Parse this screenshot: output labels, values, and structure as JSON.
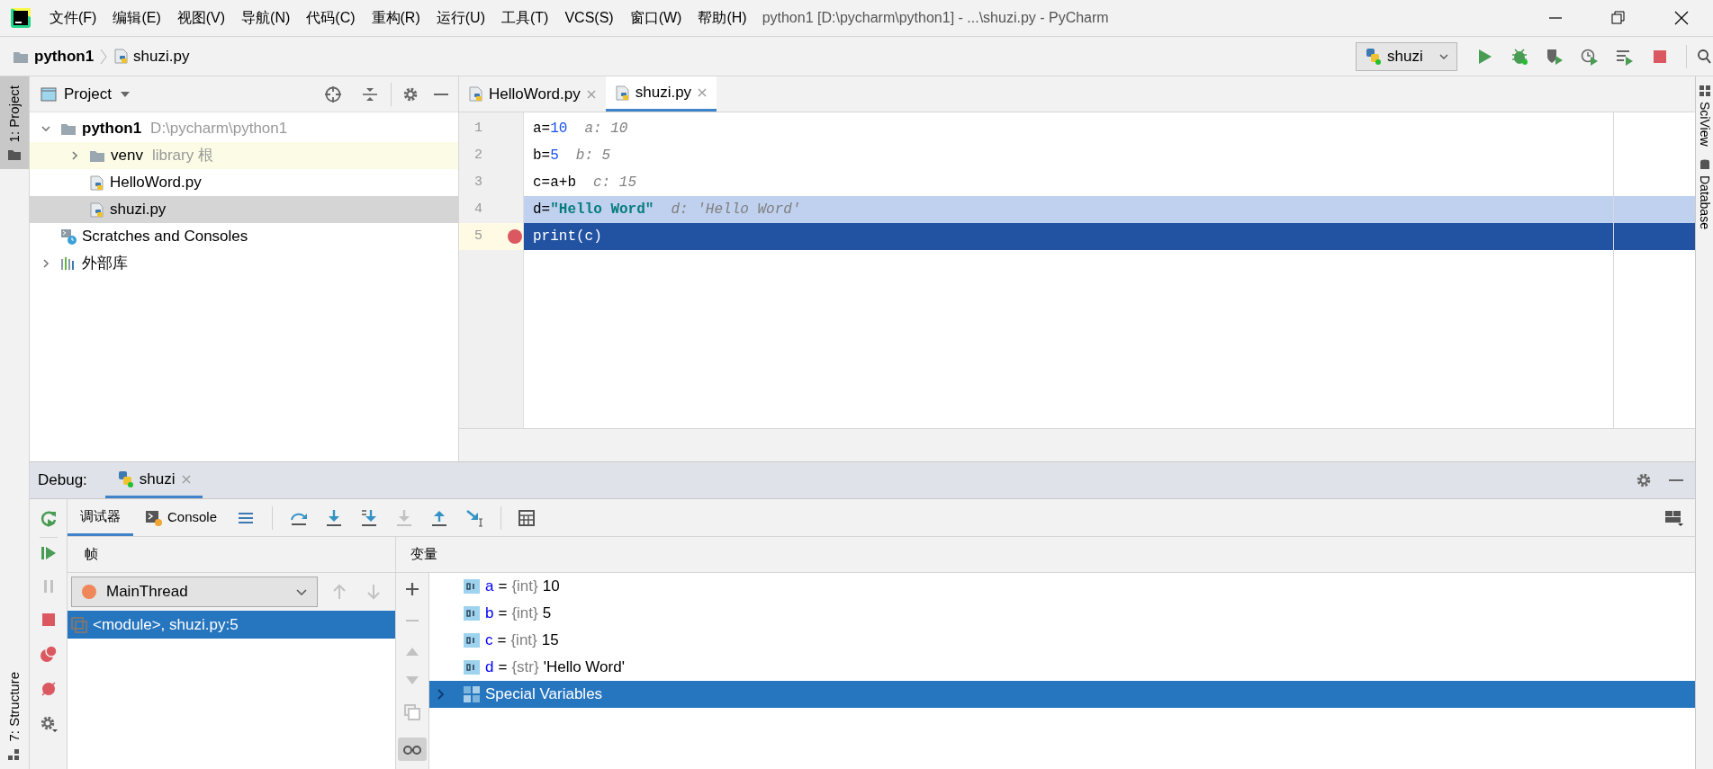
{
  "menu": [
    "文件(F)",
    "编辑(E)",
    "视图(V)",
    "导航(N)",
    "代码(C)",
    "重构(R)",
    "运行(U)",
    "工具(T)",
    "VCS(S)",
    "窗口(W)",
    "帮助(H)"
  ],
  "window_title": "python1 [D:\\pycharm\\python1] - ...\\shuzi.py - PyCharm",
  "breadcrumbs": [
    "python1",
    "shuzi.py"
  ],
  "run_config": "shuzi",
  "left_tool_tabs": [
    {
      "label": "1: Project",
      "selected": true,
      "kind": "project"
    },
    {
      "label": "7: Structure",
      "selected": false,
      "kind": "structure"
    }
  ],
  "right_tool_tabs": [
    {
      "label": "SciView",
      "kind": "sciview"
    },
    {
      "label": "Database",
      "kind": "database"
    }
  ],
  "project_panel": {
    "title": "Project",
    "tree": [
      {
        "label": "python1",
        "hint": "D:\\pycharm\\python1",
        "kind": "project",
        "expanded": true,
        "selected": false,
        "library_root": false,
        "children": [
          {
            "label": "venv",
            "hint": "library 根",
            "kind": "folder",
            "expanded": false,
            "selected": false,
            "library_root": true
          },
          {
            "label": "HelloWord.py",
            "kind": "python",
            "selected": false,
            "library_root": false
          },
          {
            "label": "shuzi.py",
            "kind": "python",
            "selected": true,
            "library_root": false
          }
        ]
      },
      {
        "label": "Scratches and Consoles",
        "kind": "scratches",
        "selected": false,
        "library_root": false
      },
      {
        "label": "外部库",
        "kind": "library",
        "expanded": false,
        "selected": false,
        "library_root": false
      }
    ]
  },
  "editor": {
    "tabs": [
      {
        "label": "HelloWord.py",
        "selected": false
      },
      {
        "label": "shuzi.py",
        "selected": true
      }
    ],
    "lines": [
      {
        "number": "1",
        "tokens": [
          {
            "text": "a=",
            "kind": "plain"
          },
          {
            "text": "10",
            "kind": "number"
          }
        ],
        "inline_value": "a: 10",
        "breakpoint": false,
        "selected": false,
        "execution_point": false
      },
      {
        "number": "2",
        "tokens": [
          {
            "text": "b=",
            "kind": "plain"
          },
          {
            "text": "5",
            "kind": "number"
          }
        ],
        "inline_value": "b: 5",
        "breakpoint": false,
        "selected": false,
        "execution_point": false
      },
      {
        "number": "3",
        "tokens": [
          {
            "text": "c=a+b",
            "kind": "plain"
          }
        ],
        "inline_value": "c: 15",
        "breakpoint": false,
        "selected": false,
        "execution_point": false
      },
      {
        "number": "4",
        "tokens": [
          {
            "text": "d=",
            "kind": "plain"
          },
          {
            "text": "\"Hello Word\"",
            "kind": "string"
          }
        ],
        "inline_value": "d: 'Hello Word'",
        "breakpoint": false,
        "selected": true,
        "execution_point": false
      },
      {
        "number": "5",
        "tokens": [
          {
            "text": "print(c)",
            "kind": "plain"
          }
        ],
        "breakpoint": true,
        "selected": false,
        "execution_point": true
      }
    ]
  },
  "debug": {
    "title": "Debug:",
    "session_tab": {
      "label": "shuzi",
      "selected": true
    },
    "subtabs": [
      {
        "label": "调试器",
        "selected": true,
        "kind": "debugger"
      },
      {
        "label": "Console",
        "selected": false,
        "kind": "console"
      }
    ],
    "frames_header": "帧",
    "variables_header": "变量",
    "thread": "MainThread",
    "frames": [
      {
        "label": "<module>, shuzi.py:5",
        "selected": true
      }
    ],
    "variables": [
      {
        "kind": "variable",
        "name": "a",
        "operator": "=",
        "type": "{int}",
        "value": "10",
        "selected": false
      },
      {
        "kind": "variable",
        "name": "b",
        "operator": "=",
        "type": "{int}",
        "value": "5",
        "selected": false
      },
      {
        "kind": "variable",
        "name": "c",
        "operator": "=",
        "type": "{int}",
        "value": "15",
        "selected": false
      },
      {
        "kind": "variable",
        "name": "d",
        "operator": "=",
        "type": "{str}",
        "value": "'Hello Word'",
        "selected": false
      },
      {
        "kind": "group",
        "name": "Special Variables",
        "selected": true
      }
    ]
  }
}
